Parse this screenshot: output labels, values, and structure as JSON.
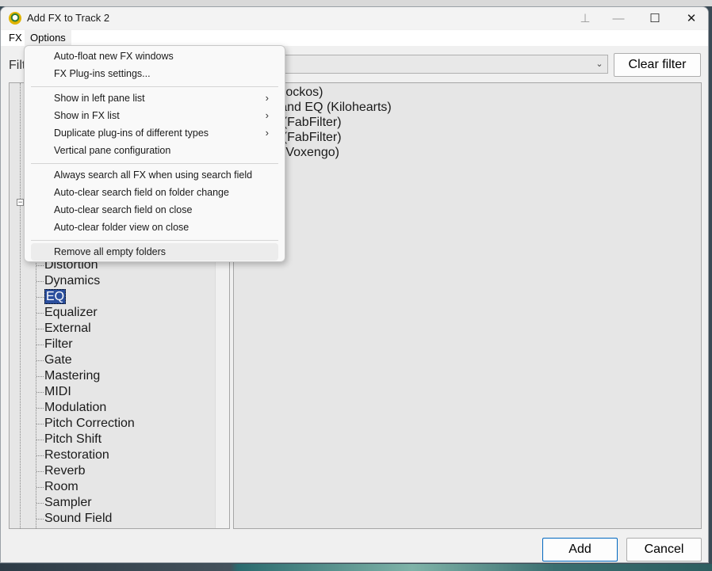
{
  "window": {
    "title": "Add FX to Track 2"
  },
  "titlebar": {
    "pin_glyph": "⊥",
    "min_glyph": "—",
    "max_glyph": "☐",
    "close_glyph": "✕"
  },
  "menubar": {
    "fx": "FX",
    "options": "Options"
  },
  "filter": {
    "label": "Filt",
    "value": "",
    "dropdown_glyph": "⌄",
    "clear_label": "Clear filter"
  },
  "tree": {
    "expander_glyph": "−",
    "items": [
      "Distortion",
      "Dynamics",
      "EQ",
      "Equalizer",
      "External",
      "Filter",
      "Gate",
      "Mastering",
      "MIDI",
      "Modulation",
      "Pitch Correction",
      "Pitch Shift",
      "Restoration",
      "Reverb",
      "Room",
      "Sampler",
      "Sound Field"
    ],
    "selected": "EQ"
  },
  "fx_list": [
    "aEQ (Cockos)",
    "ds 3-Band EQ (Kilohearts)",
    "ro-Q 3 (FabFilter)",
    "ro-Q 4 (FabFilter)",
    "EOTE (Voxengo)"
  ],
  "options_menu": {
    "group1": [
      "Auto-float new FX windows",
      "FX Plug-ins settings..."
    ],
    "group2": [
      "Show in left pane list",
      "Show in FX list",
      "Duplicate plug-ins of different types",
      "Vertical pane configuration"
    ],
    "submenu_arrow": "›",
    "group3": [
      "Always search all FX when using search field",
      "Auto-clear search field on folder change",
      "Auto-clear search field on close",
      "Auto-clear folder view on close"
    ],
    "group4": [
      "Remove all empty folders"
    ]
  },
  "buttons": {
    "add": "Add",
    "cancel": "Cancel"
  },
  "colors": {
    "selection": "#2b4f9e",
    "add_border": "#0067c0"
  }
}
